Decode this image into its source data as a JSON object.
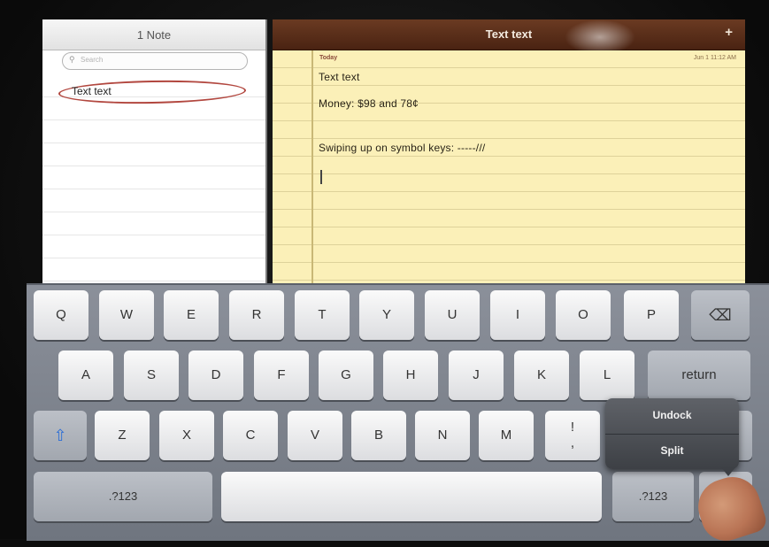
{
  "notes_list": {
    "header": "1 Note",
    "search_placeholder": "Search",
    "items": [
      {
        "title": "Text text"
      }
    ]
  },
  "note": {
    "title": "Text text",
    "add_button": "+",
    "date_label": "Today",
    "timestamp": "Jun 1  11:12 AM",
    "lines": [
      "Text text",
      "Money: $98 and 78¢",
      "Swiping up on symbol keys: -----///"
    ]
  },
  "keyboard": {
    "row1": [
      "Q",
      "W",
      "E",
      "R",
      "T",
      "Y",
      "U",
      "I",
      "O",
      "P"
    ],
    "row2": [
      "A",
      "S",
      "D",
      "F",
      "G",
      "H",
      "J",
      "K",
      "L"
    ],
    "row3": [
      "Z",
      "X",
      "C",
      "V",
      "B",
      "N",
      "M"
    ],
    "punct_key": "!\n,",
    "return_label": "return",
    "numbers_left": ".?123",
    "numbers_right": ".?123",
    "shift_symbol": "⇧",
    "delete_symbol": "⌫",
    "popup": {
      "undock": "Undock",
      "split": "Split"
    }
  },
  "colors": {
    "note_paper": "#fbf0b8",
    "title_bar": "#5a2e1a",
    "annotation_circle": "#b2473f"
  }
}
